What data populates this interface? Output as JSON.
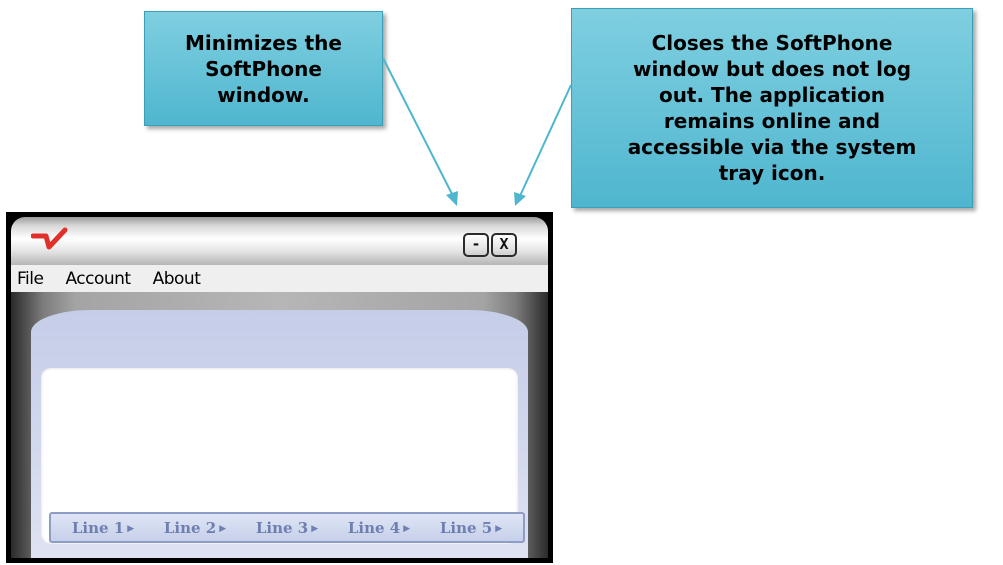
{
  "callouts": {
    "minimize": [
      "Minimizes the",
      "SoftPhone",
      "window."
    ],
    "close": [
      "Closes the SoftPhone",
      "window but does not log",
      "out.  The application",
      "remains online and",
      "accessible via the system",
      "tray icon."
    ]
  },
  "window": {
    "logo_icon": "brand-check-logo",
    "minimize_label": "-",
    "close_label": "X",
    "menu": [
      "File",
      "Account",
      "About"
    ],
    "lines": [
      "Line 1",
      "Line 2",
      "Line 3",
      "Line 4",
      "Line 5"
    ],
    "line_arrow": "▶"
  },
  "colors": {
    "callout_fill": "#5cbdd4",
    "arrow": "#4fb6cf",
    "logo_red": "#e0302a",
    "line_text": "#6f7fb0"
  }
}
